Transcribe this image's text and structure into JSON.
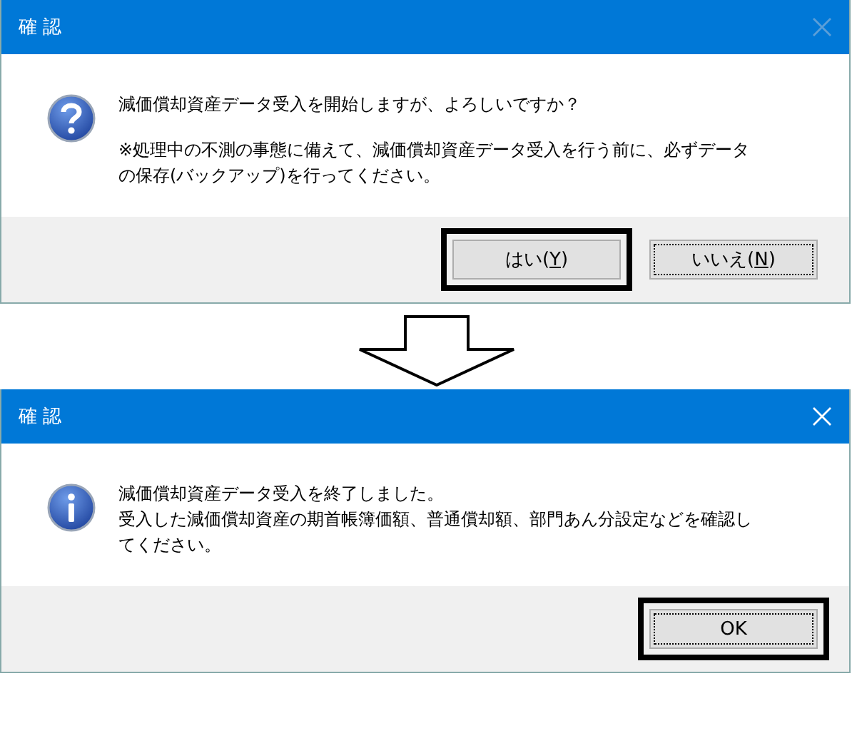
{
  "dialogs": [
    {
      "title": "確 認",
      "close_disabled": true,
      "kind": "question",
      "message": [
        "減価償却資産データ受入を開始しますが、よろしいですか？",
        "※処理中の不測の事態に備えて、減価償却資産データ受入を行う前に、必ずデータの保存(バックアップ)を行ってください。"
      ],
      "buttons": [
        {
          "before": "はい(",
          "accesskey": "Y",
          "after": ")",
          "highlighted": true,
          "focused": false
        },
        {
          "before": "いいえ(",
          "accesskey": "N",
          "after": ")",
          "highlighted": false,
          "focused": true
        }
      ]
    },
    {
      "title": "確 認",
      "close_disabled": false,
      "kind": "info",
      "message": [
        "減価償却資産データ受入を終了しました。",
        "受入した減価償却資産の期首帳簿価額、普通償却額、部門あん分設定などを確認してください。"
      ],
      "buttons": [
        {
          "before": "OK",
          "highlighted": true,
          "focused": true
        }
      ]
    }
  ]
}
